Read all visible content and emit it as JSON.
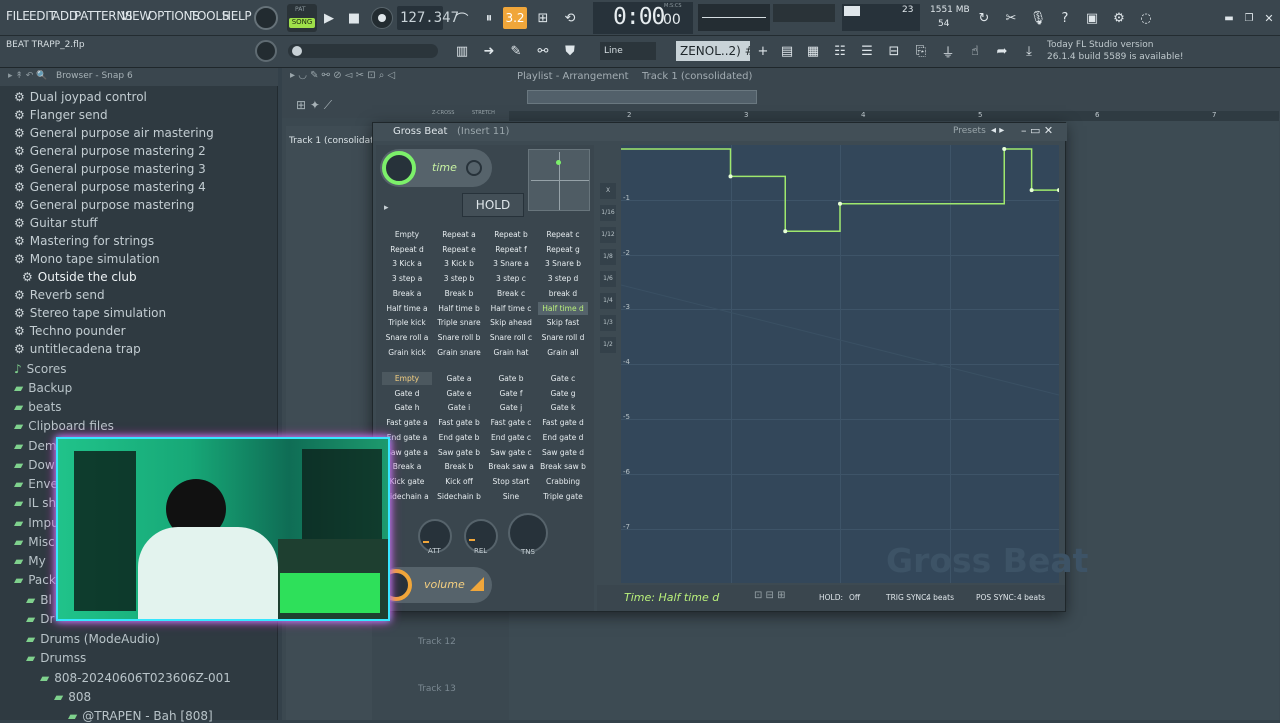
{
  "menu": [
    "FILE",
    "EDIT",
    "ADD",
    "PATTERNS",
    "VIEW",
    "OPTIONS",
    "TOOLS",
    "HELP"
  ],
  "transport": {
    "pat": "PAT",
    "song": "SONG",
    "tempo": "127.347",
    "time": "0:00",
    "time_ms": "00",
    "mscs": "M:S:CS",
    "beat": "3.2"
  },
  "status": {
    "cpu": "23",
    "ram": "1551 MB",
    "poly": "54"
  },
  "row2": {
    "project": "BEAT TRAPP_2.flp",
    "snap": "Line",
    "pattern": "ZENOL..2) #2"
  },
  "news": {
    "line1": "Today  FL Studio version",
    "line2": "26.1.4 build 5589 is available!"
  },
  "browser": {
    "header": "Browser - Snap 6",
    "presets": [
      "Dual joypad control",
      "Flanger send",
      "General purpose air mastering",
      "General purpose mastering 2",
      "General purpose mastering 3",
      "General purpose mastering 4",
      "General purpose mastering",
      "Guitar stuff",
      "Mastering for strings",
      "Mono tape simulation",
      "Outside the club",
      "Reverb send",
      "Stereo tape simulation",
      "Techno pounder",
      "untitlecadena trap"
    ],
    "folders": [
      "Scores",
      "Backup",
      "beats",
      "Clipboard files",
      "Dem",
      "Dow",
      "Enve",
      "IL sh",
      "Impu",
      "Misc",
      "My",
      "Pack",
      "Bl",
      "Dr",
      "Drums (ModeAudio)",
      "Drumss",
      "808-20240606T023606Z-001",
      "808",
      "@TRAPEN - Bah [808]"
    ]
  },
  "playlist": {
    "breadcrumb": "Playlist - Arrangement",
    "track": "Track 1 (consolidated)",
    "track_label": "Track 1 (consolidatec",
    "labels": [
      "Z-CROSS",
      "STRETCH"
    ],
    "ruler": [
      "2",
      "3",
      "4",
      "5",
      "6",
      "7"
    ],
    "tracks": [
      "Track 12",
      "Track 13"
    ]
  },
  "grossbeat": {
    "title": "Gross Beat",
    "insert": "(Insert 11)",
    "presets": "Presets",
    "time_label": "time",
    "hold": "HOLD",
    "volume_label": "volume",
    "time_presets": [
      "Empty",
      "Repeat a",
      "Repeat b",
      "Repeat c",
      "Repeat d",
      "Repeat e",
      "Repeat f",
      "Repeat g",
      "3 Kick a",
      "3 Kick b",
      "3 Snare a",
      "3 Snare b",
      "3 step a",
      "3 step b",
      "3 step c",
      "3 step d",
      "Break a",
      "Break b",
      "Break c",
      "break d",
      "Half time a",
      "Half time b",
      "Half time c",
      "Half time d",
      "Triple kick",
      "Triple snare",
      "Skip ahead",
      "Skip fast",
      "Snare roll a",
      "Snare roll b",
      "Snare roll c",
      "Snare roll d",
      "Grain kick",
      "Grain snare",
      "Grain hat",
      "Grain all"
    ],
    "volume_presets": [
      "Empty",
      "Gate a",
      "Gate b",
      "Gate c",
      "Gate d",
      "Gate e",
      "Gate f",
      "Gate g",
      "Gate h",
      "Gate i",
      "Gate j",
      "Gate k",
      "Fast gate a",
      "Fast gate b",
      "Fast gate c",
      "Fast gate d",
      "End gate a",
      "End gate b",
      "End gate c",
      "End gate d",
      "Saw gate a",
      "Saw gate b",
      "Saw gate c",
      "Saw gate d",
      "Break a",
      "Break b",
      "Break saw a",
      "Break saw b",
      "Kick gate",
      "Kick off",
      "Stop start",
      "Crabbing",
      "Sidechain a",
      "Sidechain b",
      "Sine",
      "Triple gate"
    ],
    "knobs": [
      "ATT",
      "REL",
      "TNS"
    ],
    "side": [
      "X",
      "1/16",
      "1/12",
      "1/8",
      "1/6",
      "1/4",
      "1/3",
      "1/2"
    ],
    "ylabels": [
      "-1",
      "-2",
      "-3",
      "-4",
      "-5",
      "-6",
      "-7"
    ],
    "footer": {
      "status": "Time: Half time d",
      "hold_label": "HOLD:",
      "hold": "Off",
      "trig_label": "TRIG SYNC:",
      "trig": "4 beats",
      "pos_label": "POS SYNC:",
      "pos": "4 beats"
    },
    "watermark": "Gross Beat",
    "envelope": [
      [
        0,
        0
      ],
      [
        0.25,
        0
      ],
      [
        0.25,
        -0.5
      ],
      [
        0.375,
        -0.5
      ],
      [
        0.375,
        -1.5
      ],
      [
        0.5,
        -1.5
      ],
      [
        0.5,
        -1
      ],
      [
        0.875,
        -1
      ],
      [
        0.875,
        0
      ],
      [
        0.9375,
        0
      ],
      [
        0.9375,
        -0.75
      ],
      [
        1,
        -0.75
      ]
    ]
  },
  "colors": {
    "accent": "#7cf06a",
    "orange": "#f0a63a",
    "panel": "#3d4a52",
    "graph": "#33475a"
  }
}
